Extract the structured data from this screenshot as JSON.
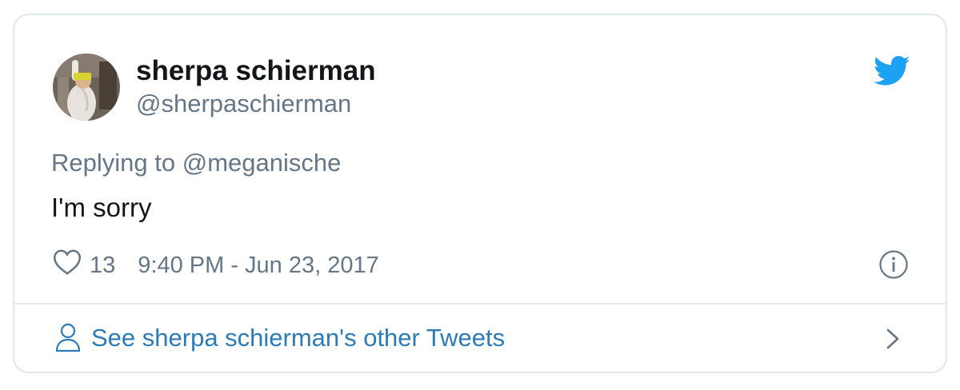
{
  "tweet": {
    "display_name": "sherpa schierman",
    "handle": "@sherpaschierman",
    "replying_prefix": "Replying to",
    "replying_handle": "@meganische",
    "text": "I'm sorry",
    "likes": "13",
    "timestamp": "9:40 PM - Jun 23, 2017"
  },
  "footer": {
    "other_tweets_label": "See sherpa schierman's other Tweets"
  },
  "icons": {
    "brand": "twitter-bird-icon",
    "like": "heart-icon",
    "info": "info-icon",
    "profile": "person-icon",
    "more": "chevron-right-icon"
  },
  "colors": {
    "brand": "#1da1f2",
    "link": "#2b7bb9",
    "text": "#14171a",
    "muted": "#657786",
    "border": "#e1e8ed"
  }
}
